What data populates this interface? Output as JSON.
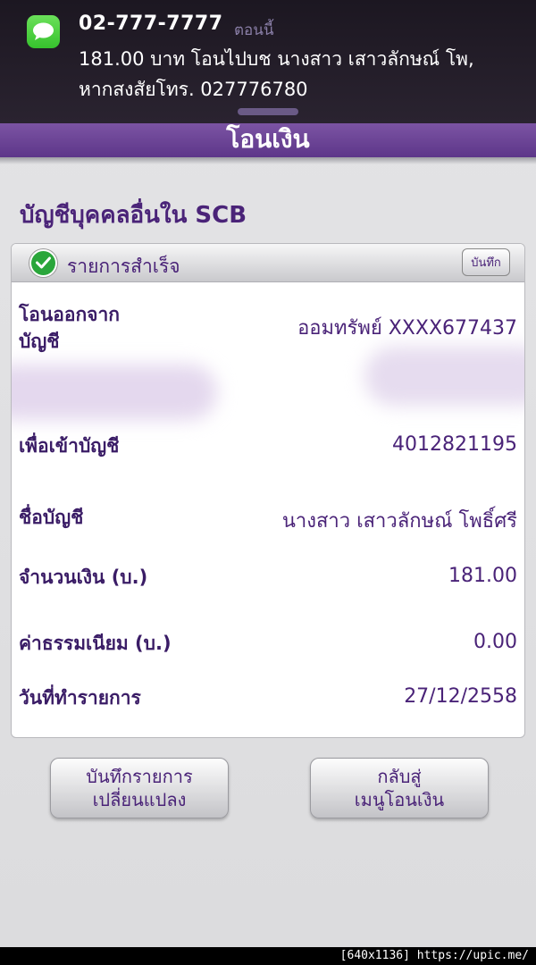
{
  "notification": {
    "sender": "02-777-7777",
    "time": "ตอนนี้",
    "line1": "181.00 บาท โอนไปบช นางสาว เสาวลักษณ์ โพ,",
    "line2": "หากสงสัยโทร. 027776780",
    "icon": "messages-icon"
  },
  "header": {
    "title": "โอนเงิน"
  },
  "page": {
    "title": "บัญชีบุคคลอื่นใน SCB"
  },
  "panel": {
    "status": "รายการสำเร็จ",
    "save_label": "บันทึก",
    "rows": {
      "from_account": {
        "label_1": "โอนออกจาก",
        "label_2": "บัญชี",
        "value": "ออมทรัพย์ XXXX677437"
      },
      "to_account": {
        "label": "เพื่อเข้าบัญชี",
        "value": "4012821195"
      },
      "account_name": {
        "label": "ชื่อบัญชี",
        "value": "นางสาว เสาวลักษณ์ โพธิ์ศรี"
      },
      "amount": {
        "label": "จำนวนเงิน (บ.)",
        "value": "181.00"
      },
      "fee": {
        "label": "ค่าธรรมเนียม (บ.)",
        "value": "0.00"
      },
      "date": {
        "label": "วันที่ทำรายการ",
        "value": "27/12/2558"
      }
    }
  },
  "buttons": {
    "save_changes_1": "บันทึกรายการ",
    "save_changes_2": "เปลี่ยนแปลง",
    "back_1": "กลับสู่",
    "back_2": "เมนูโอนเงิน"
  },
  "watermark": "[640x1136] https://upic.me/",
  "colors": {
    "accent": "#5d3689",
    "text": "#4a2378",
    "success": "#2aa63b"
  }
}
